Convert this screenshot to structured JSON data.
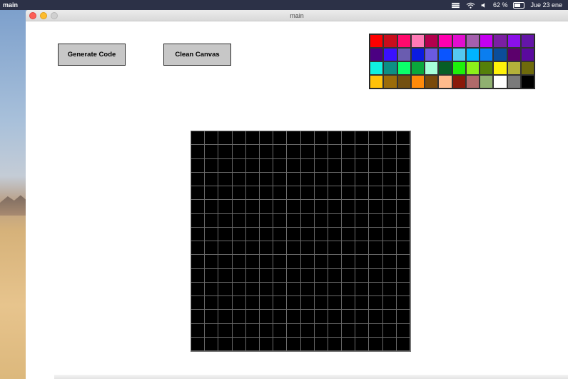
{
  "menubar": {
    "app_name": "main",
    "battery_percent": "62 %",
    "battery_level": 0.62,
    "datetime": "Jue 23 ene",
    "icons": [
      "stack-icon",
      "wifi-icon",
      "speaker-icon",
      "battery-icon"
    ]
  },
  "window": {
    "title": "main"
  },
  "buttons": {
    "generate_label": "Generate Code",
    "clean_label": "Clean Canvas"
  },
  "palette": {
    "colors": [
      "#ff0000",
      "#c80d1c",
      "#ff0a6c",
      "#ff7ab6",
      "#b3004d",
      "#ff00b0",
      "#e20ed0",
      "#a55fae",
      "#c400f0",
      "#7b1fa2",
      "#8b10e8",
      "#6415a8",
      "#4b0082",
      "#3a10ff",
      "#6a5cb0",
      "#0a1be0",
      "#6a5ae0",
      "#0a55ff",
      "#55c8f0",
      "#00b4ff",
      "#0a7ef0",
      "#0b4d9a",
      "#5c006c",
      "#5a0a9e",
      "#10f0e0",
      "#0c8f84",
      "#0aff6a",
      "#0aa83c",
      "#a6ffd8",
      "#075e26",
      "#1ef00a",
      "#8cf01a",
      "#55800a",
      "#fff20a",
      "#b3b03a",
      "#6e6a0c",
      "#ffc10a",
      "#9b6c0a",
      "#735010",
      "#ff8a0a",
      "#7a4a0a",
      "#ffbb8c",
      "#8a1a0a",
      "#b06a6a",
      "#90b070",
      "#ffffff",
      "#7a7a7a",
      "#000000"
    ]
  },
  "canvas": {
    "columns": 16,
    "rows": 16,
    "fill_color": "#000000",
    "grid_color": "#6a6a6a"
  }
}
